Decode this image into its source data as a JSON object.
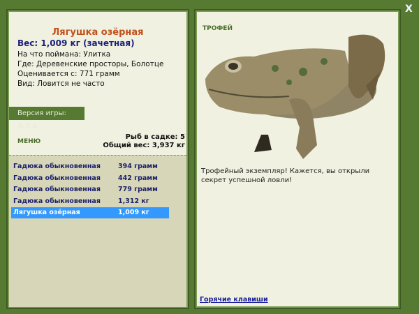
{
  "fish": {
    "name": "Лягушка озёрная",
    "weight": "Вес: 1,009 кг (зачетная)",
    "info": [
      "На что поймана: Улитка",
      "Где: Деревенские просторы, Болотце",
      "Оценивается с: 771 грамм",
      "Вид: Ловится не часто"
    ]
  },
  "version": {
    "label": "Версия игры: ",
    "value": "3.7.6"
  },
  "menu_label": "МЕНЮ",
  "stats": {
    "count": "Рыб в садке: 5",
    "total": "Общий вес: 3,937 кг"
  },
  "catch": [
    {
      "name": "Гадюка обыкновенная",
      "weight": "394 грамм"
    },
    {
      "name": "Гадюка обыкновенная",
      "weight": "442 грамм"
    },
    {
      "name": "Гадюка обыкновенная",
      "weight": "779 грамм"
    },
    {
      "name": "Гадюка обыкновенная",
      "weight": "1,312 кг"
    },
    {
      "name": "Лягушка озёрная",
      "weight": "1,009 кг",
      "selected": true
    }
  ],
  "trophy": {
    "label": "ТРОФЕЙ",
    "description": "Трофейный экземпляр! Кажется, вы открыли секрет успешной ловли!"
  },
  "hotkeys": "Горячие клавиши",
  "close": "X",
  "colors": {
    "background": "#567a32",
    "title": "#c2501c",
    "selected": "#3399ff"
  }
}
